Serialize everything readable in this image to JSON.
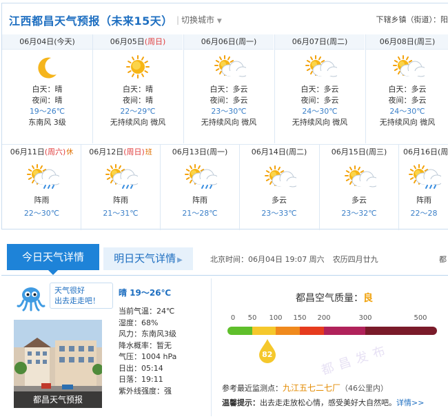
{
  "header": {
    "title": "江西都昌天气预报（未来15天）",
    "switch_city": "切换城市",
    "town_label": "下辖乡镇（街道）：阳"
  },
  "forecast_row1": [
    {
      "date": "06月04日",
      "weekday": "今天",
      "weekday_red": false,
      "weekday_bold": true,
      "icon": "moon-icon",
      "day_label": "白天：晴",
      "night_label": "夜间：晴",
      "temp": "19～26℃",
      "wind": "东南风 3级"
    },
    {
      "date": "06月05日",
      "weekday": "周日",
      "weekday_red": true,
      "icon": "sun-icon",
      "day_label": "白天：晴",
      "night_label": "夜间：晴",
      "temp": "22～29℃",
      "wind": "无持续风向 微风"
    },
    {
      "date": "06月06日",
      "weekday": "周一",
      "weekday_red": false,
      "icon": "partly-cloudy-icon",
      "day_label": "白天：多云",
      "night_label": "夜间：多云",
      "temp": "23～30℃",
      "wind": "无持续风向 微风"
    },
    {
      "date": "06月07日",
      "weekday": "周二",
      "weekday_red": false,
      "icon": "partly-cloudy-icon",
      "day_label": "白天：多云",
      "night_label": "夜间：多云",
      "temp": "24～30℃",
      "wind": "无持续风向 微风"
    },
    {
      "date": "06月08日",
      "weekday": "周三",
      "weekday_red": false,
      "icon": "partly-cloudy-icon",
      "day_label": "白天：多云",
      "night_label": "夜间：多云",
      "temp": "24～30℃",
      "wind": "无持续风向 微风"
    }
  ],
  "forecast_row2": [
    {
      "date": "06月11日",
      "weekday": "周六",
      "weekday_red": true,
      "badge": "休",
      "icon": "sun-rain-icon",
      "desc": "阵雨",
      "temp": "22～30℃"
    },
    {
      "date": "06月12日",
      "weekday": "周日",
      "weekday_red": true,
      "badge": "班",
      "icon": "sun-rain-icon",
      "desc": "阵雨",
      "temp": "21～31℃"
    },
    {
      "date": "06月13日",
      "weekday": "周一",
      "weekday_red": false,
      "badge": "",
      "icon": "sun-rain-icon",
      "desc": "阵雨",
      "temp": "21～28℃"
    },
    {
      "date": "06月14日",
      "weekday": "周二",
      "weekday_red": false,
      "badge": "",
      "icon": "partly-cloudy-icon",
      "desc": "多云",
      "temp": "23～33℃"
    },
    {
      "date": "06月15日",
      "weekday": "周三",
      "weekday_red": false,
      "badge": "",
      "icon": "partly-cloudy-icon",
      "desc": "多云",
      "temp": "23～32℃"
    },
    {
      "date": "06月16日",
      "weekday": "周",
      "weekday_red": false,
      "badge": "",
      "icon": "sun-rain-icon",
      "desc": "阵雨",
      "temp": "22～28"
    }
  ],
  "tabs": {
    "today": "今日天气详情",
    "tomorrow": "明日天气详情",
    "tomorrow_arrow": ">"
  },
  "beijing_time": {
    "label": "北京时间：06月04日  19:07  周六",
    "lunar": "农历四月廿九",
    "more": "都"
  },
  "mascot_bubble": {
    "line1": "天气很好",
    "line2": "出去走走吧！"
  },
  "photo_caption": "都昌天气预报",
  "today_detail": {
    "weather": "晴  19～26℃",
    "lines": [
      "当前气温：24℃",
      "湿度：68%",
      "风力：东南风3级",
      "降水概率：暂无",
      "气压：1004 hPa",
      "日出：05:14",
      "日落：19:11",
      "紫外线强度：强"
    ]
  },
  "aqi": {
    "title": "都昌空气质量：",
    "level": "良",
    "scale": [
      "0",
      "50",
      "100",
      "150",
      "200",
      "300",
      "500"
    ],
    "value": "82",
    "value_num": 82,
    "colors": [
      "#5fbf2b",
      "#f5c82c",
      "#f08a1d",
      "#e63b1e",
      "#b0225a",
      "#7a1b2a"
    ],
    "watermark": "都昌发布",
    "station_label": "参考最近监测点：",
    "station_name": "九江五七二七厂",
    "station_dist": "（46公里内）",
    "tip_label": "温馨提示：",
    "tip_text": "出去走走放松心情，感受美好大自然吧。",
    "tip_more": "详情>>"
  }
}
